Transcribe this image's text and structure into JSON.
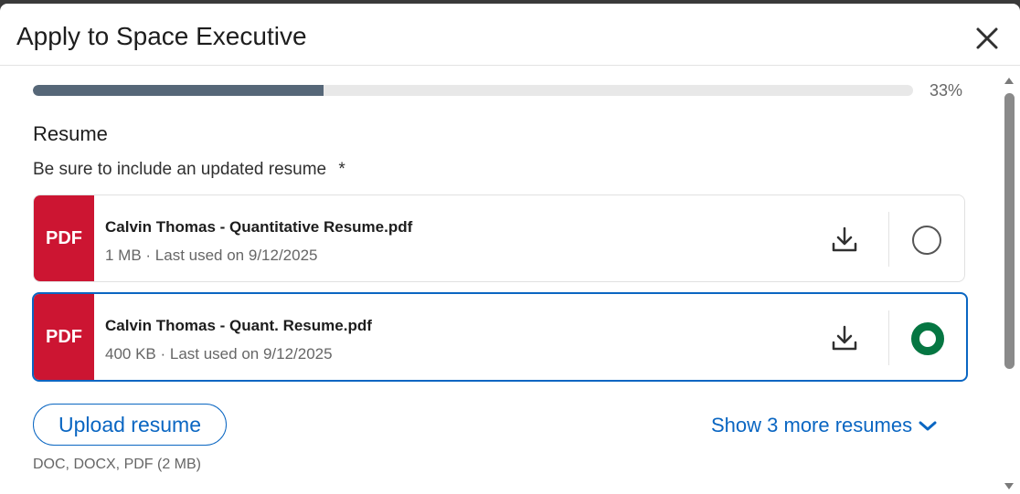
{
  "dialog": {
    "title": "Apply to Space Executive",
    "close_icon": "close-icon"
  },
  "progress": {
    "percent": 33,
    "label": "33%",
    "fill_color": "#566778"
  },
  "resume_section": {
    "heading": "Resume",
    "instruction": "Be sure to include an updated resume",
    "required_marker": "*"
  },
  "resumes": [
    {
      "badge": "PDF",
      "name": "Calvin Thomas - Quantitative Resume.pdf",
      "meta": "1 MB · Last used on 9/12/2025",
      "selected": false,
      "download_icon": "download-icon"
    },
    {
      "badge": "PDF",
      "name": "Calvin Thomas - Quant. Resume.pdf",
      "meta": "400 KB · Last used on 9/12/2025",
      "selected": true,
      "download_icon": "download-icon"
    }
  ],
  "actions": {
    "upload_label": "Upload resume",
    "show_more_label": "Show 3 more resumes",
    "file_types": "DOC, DOCX, PDF (2 MB)"
  },
  "colors": {
    "brand_blue": "#0a66c2",
    "pdf_red": "#cc1532",
    "selected_green": "#057642"
  }
}
